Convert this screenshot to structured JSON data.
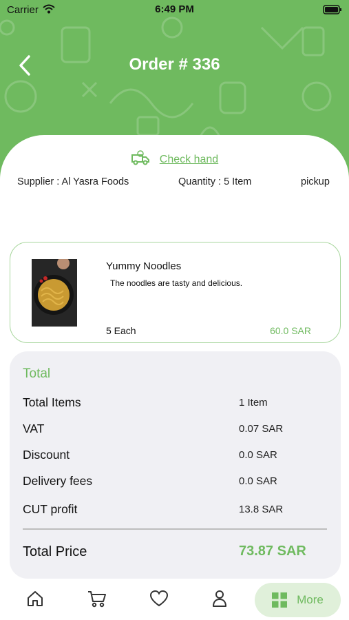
{
  "status_bar": {
    "carrier": "Carrier",
    "time": "6:49 PM",
    "icons": [
      "wifi-icon",
      "battery-icon"
    ]
  },
  "header": {
    "title": "Order # 336",
    "back_icon": "chevron-left-icon",
    "background_color": "#6fba5f"
  },
  "order_info": {
    "check_link": "Check hand",
    "check_icon": "delivery-truck-icon",
    "supplier": "Supplier : Al Yasra Foods",
    "quantity": "Quantity : 5 Item",
    "method": "pickup"
  },
  "items": [
    {
      "name": "Yummy Noodles",
      "description": "The noodles are tasty and delicious.",
      "quantity": "5 Each",
      "price": "60.0 SAR"
    }
  ],
  "summary": {
    "title": "Total",
    "rows": [
      {
        "label": "Total Items",
        "value": "1 Item"
      },
      {
        "label": "VAT",
        "value": "0.07 SAR"
      },
      {
        "label": "Discount",
        "value": "0.0 SAR"
      },
      {
        "label": "Delivery fees",
        "value": "0.0 SAR"
      },
      {
        "label": "CUT profit",
        "value": "13.8 SAR"
      }
    ],
    "total_label": "Total Price",
    "total_value": "73.87 SAR"
  },
  "bottom_nav": {
    "items": [
      {
        "icon": "home-icon"
      },
      {
        "icon": "cart-icon"
      },
      {
        "icon": "heart-icon"
      },
      {
        "icon": "user-icon"
      }
    ],
    "active": {
      "icon": "grid-icon",
      "label": "More"
    }
  },
  "colors": {
    "accent": "#6fba5f",
    "summary_bg": "#f0f0f4",
    "active_nav_bg": "#e0f0da"
  }
}
